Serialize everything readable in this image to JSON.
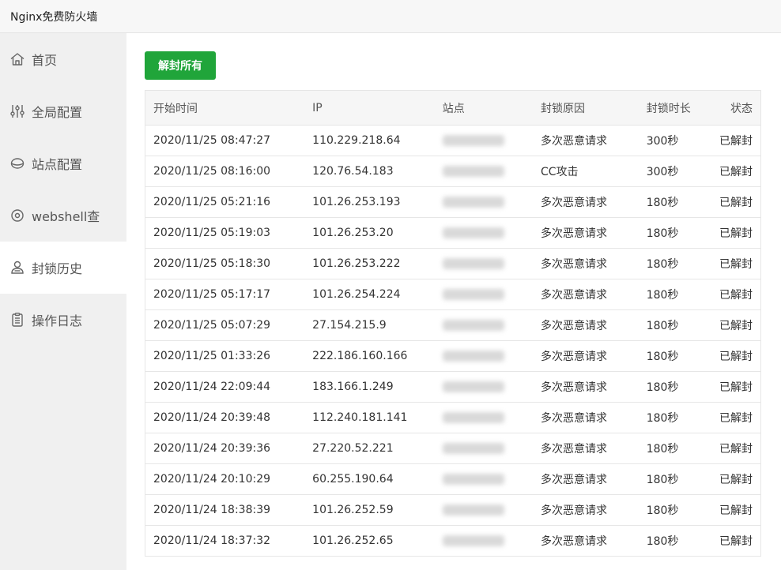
{
  "window": {
    "title": "Nginx免费防火墙"
  },
  "sidebar": {
    "items": [
      {
        "label": "首页",
        "icon": "home-icon"
      },
      {
        "label": "全局配置",
        "icon": "sliders-icon"
      },
      {
        "label": "站点配置",
        "icon": "globe-icon"
      },
      {
        "label": "webshell查",
        "icon": "scan-icon"
      },
      {
        "label": "封锁历史",
        "icon": "user-lock-icon",
        "active": true
      },
      {
        "label": "操作日志",
        "icon": "clipboard-icon"
      }
    ]
  },
  "toolbar": {
    "unban_all_label": "解封所有"
  },
  "table": {
    "headers": [
      "开始时间",
      "IP",
      "站点",
      "封锁原因",
      "封锁时长",
      "状态"
    ],
    "rows": [
      {
        "time": "2020/11/25 08:47:27",
        "ip": "110.229.218.64",
        "reason": "多次恶意请求",
        "duration": "300秒",
        "status": "已解封"
      },
      {
        "time": "2020/11/25 08:16:00",
        "ip": "120.76.54.183",
        "reason": "CC攻击",
        "duration": "300秒",
        "status": "已解封"
      },
      {
        "time": "2020/11/25 05:21:16",
        "ip": "101.26.253.193",
        "reason": "多次恶意请求",
        "duration": "180秒",
        "status": "已解封"
      },
      {
        "time": "2020/11/25 05:19:03",
        "ip": "101.26.253.20",
        "reason": "多次恶意请求",
        "duration": "180秒",
        "status": "已解封"
      },
      {
        "time": "2020/11/25 05:18:30",
        "ip": "101.26.253.222",
        "reason": "多次恶意请求",
        "duration": "180秒",
        "status": "已解封"
      },
      {
        "time": "2020/11/25 05:17:17",
        "ip": "101.26.254.224",
        "reason": "多次恶意请求",
        "duration": "180秒",
        "status": "已解封"
      },
      {
        "time": "2020/11/25 05:07:29",
        "ip": "27.154.215.9",
        "reason": "多次恶意请求",
        "duration": "180秒",
        "status": "已解封"
      },
      {
        "time": "2020/11/25 01:33:26",
        "ip": "222.186.160.166",
        "reason": "多次恶意请求",
        "duration": "180秒",
        "status": "已解封"
      },
      {
        "time": "2020/11/24 22:09:44",
        "ip": "183.166.1.249",
        "reason": "多次恶意请求",
        "duration": "180秒",
        "status": "已解封"
      },
      {
        "time": "2020/11/24 20:39:48",
        "ip": "112.240.181.141",
        "reason": "多次恶意请求",
        "duration": "180秒",
        "status": "已解封"
      },
      {
        "time": "2020/11/24 20:39:36",
        "ip": "27.220.52.221",
        "reason": "多次恶意请求",
        "duration": "180秒",
        "status": "已解封"
      },
      {
        "time": "2020/11/24 20:10:29",
        "ip": "60.255.190.64",
        "reason": "多次恶意请求",
        "duration": "180秒",
        "status": "已解封"
      },
      {
        "time": "2020/11/24 18:38:39",
        "ip": "101.26.252.59",
        "reason": "多次恶意请求",
        "duration": "180秒",
        "status": "已解封"
      },
      {
        "time": "2020/11/24 18:37:32",
        "ip": "101.26.252.65",
        "reason": "多次恶意请求",
        "duration": "180秒",
        "status": "已解封"
      }
    ]
  },
  "colors": {
    "accent": "#20a53a",
    "sidebar_bg": "#f0f0f0",
    "header_bg": "#f6f6f6"
  }
}
